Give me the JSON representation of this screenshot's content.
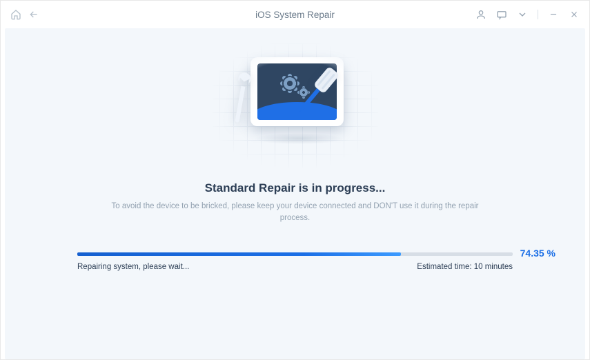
{
  "titlebar": {
    "title": "iOS System Repair"
  },
  "main": {
    "heading": "Standard Repair is in progress...",
    "subtext": "To avoid the device to be bricked, please keep your device connected and DON'T use it during the repair process."
  },
  "progress": {
    "percent_value": 74.35,
    "percent_label": "74.35 %",
    "status_text": "Repairing system, please wait...",
    "estimated_label": "Estimated time: 10 minutes"
  }
}
